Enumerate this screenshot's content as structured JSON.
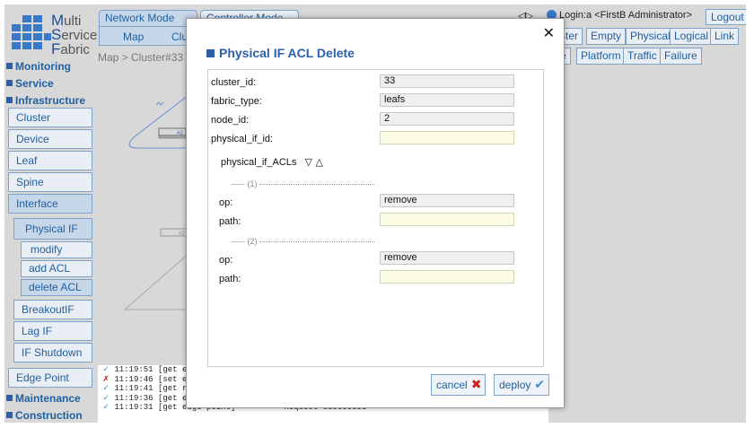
{
  "logo": {
    "l1_big": "M",
    "l1_rest": "ulti",
    "l2_big": "S",
    "l2_rest": "ervice",
    "l3_big": "F",
    "l3_rest": "abric"
  },
  "tabs": {
    "network_mode": "Network Mode",
    "controller_mode": "Controller Mode"
  },
  "subtabs": {
    "map": "Map",
    "cluster": "Clus"
  },
  "breadcrumb": "Map > Cluster#33",
  "header": {
    "arrows": "◁▷",
    "login": "Login:a <FirstB Administrator>",
    "logout": "Logout"
  },
  "right_buttons_row1": [
    "ster",
    "Empty",
    "Physical",
    "Logical",
    "Link"
  ],
  "right_buttons_row2": [
    "e",
    "Platform",
    "Traffic",
    "Failure"
  ],
  "sidebar": {
    "monitoring": "Monitoring",
    "service": "Service",
    "infrastructure": "Infrastructure",
    "cluster": "Cluster",
    "device": "Device",
    "leaf": "Leaf",
    "spine": "Spine",
    "interface": "Interface",
    "physical_if": "Physical IF",
    "modify": "modify",
    "add_acl": "add ACL",
    "delete_acl": "delete ACL",
    "breakout_if": "BreakoutIF",
    "lag_if": "Lag IF",
    "if_shutdown": "IF Shutdown",
    "edge_point": "Edge Point",
    "maintenance": "Maintenance",
    "construction": "Construction"
  },
  "map": {
    "node_label_1": "#2",
    "node_label_2": "#2",
    "cluster_label": "2"
  },
  "log": [
    {
      "status": "ok",
      "time": "11:19:51",
      "msg": "[get e"
    },
    {
      "status": "error",
      "time": "11:19:46",
      "msg": "[set e"
    },
    {
      "status": "ok",
      "time": "11:19:41",
      "msg": "[get r"
    },
    {
      "status": "ok",
      "time": "11:19:36",
      "msg": "[get e"
    },
    {
      "status": "ok",
      "time": "11:19:31",
      "msg": "[get edge-point]",
      "result": "Request Succeeded"
    }
  ],
  "modal": {
    "title": "Physical IF ACL Delete",
    "close": "✕",
    "fields": {
      "cluster_id": {
        "label": "cluster_id:",
        "value": "33"
      },
      "fabric_type": {
        "label": "fabric_type:",
        "value": "leafs"
      },
      "node_id": {
        "label": "node_id:",
        "value": "2"
      },
      "physical_if_id": {
        "label": "physical_if_id:",
        "value": ""
      }
    },
    "acl_section": {
      "label": "physical_if_ACLs",
      "arrows": "▽ △"
    },
    "entries": [
      {
        "sep": "----- (1)",
        "op_label": "op:",
        "op_value": "remove",
        "path_label": "path:",
        "path_value": ""
      },
      {
        "sep": "----- (2)",
        "op_label": "op:",
        "op_value": "remove",
        "path_label": "path:",
        "path_value": ""
      }
    ],
    "cancel": "cancel",
    "deploy": "deploy"
  },
  "colors": {
    "accent": "#2b5fa8",
    "link": "#2060a0",
    "error": "#d02020",
    "ok": "#3a8fd0"
  }
}
